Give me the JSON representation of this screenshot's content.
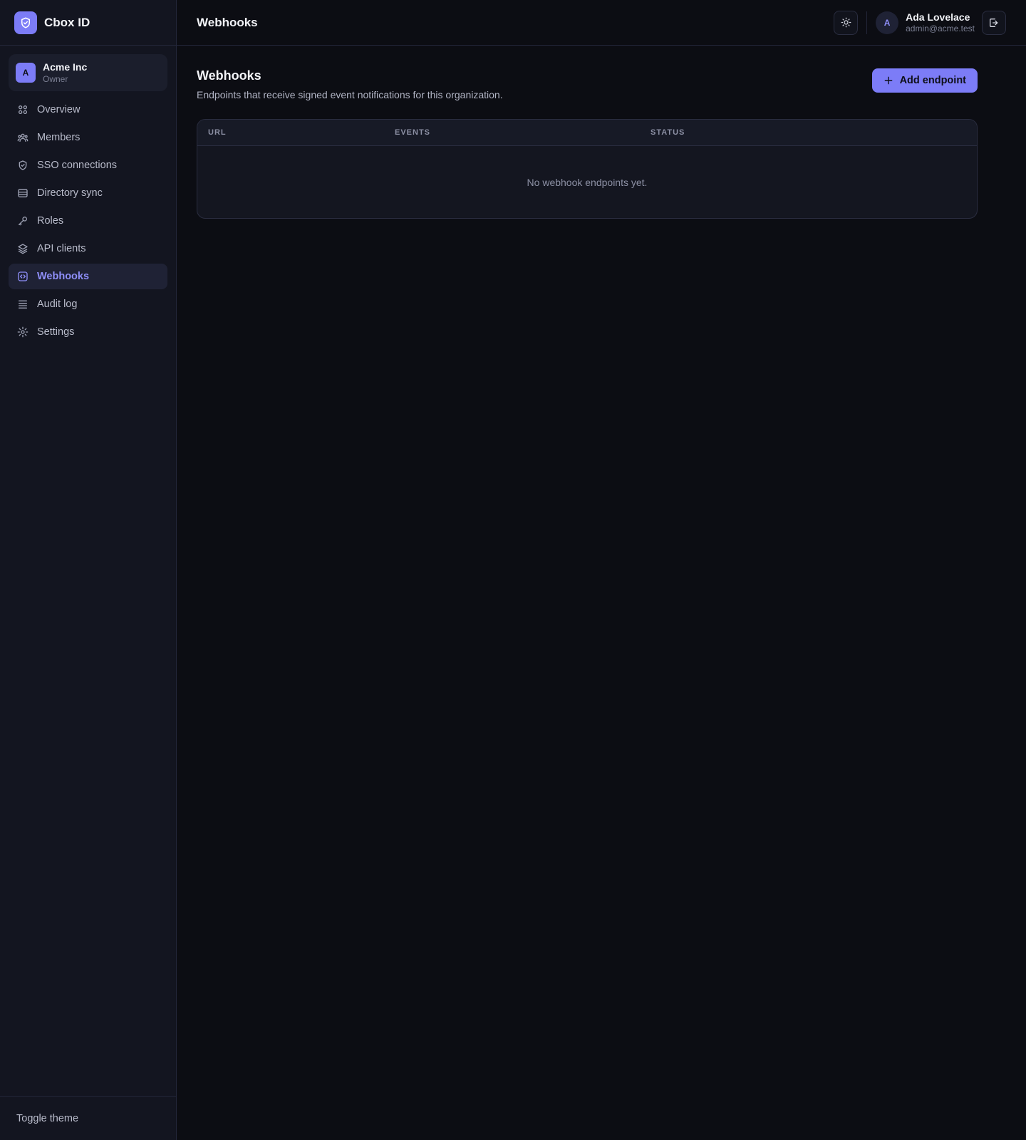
{
  "app": {
    "name": "Cbox ID"
  },
  "org": {
    "avatar": "A",
    "name": "Acme Inc",
    "role": "Owner"
  },
  "nav": [
    {
      "label": "Overview",
      "icon": "grid-icon"
    },
    {
      "label": "Members",
      "icon": "users-icon"
    },
    {
      "label": "SSO connections",
      "icon": "shield-icon"
    },
    {
      "label": "Directory sync",
      "icon": "database-icon"
    },
    {
      "label": "Roles",
      "icon": "key-icon"
    },
    {
      "label": "API clients",
      "icon": "layers-icon"
    },
    {
      "label": "Webhooks",
      "icon": "webhook-icon",
      "active": true
    },
    {
      "label": "Audit log",
      "icon": "list-icon"
    },
    {
      "label": "Settings",
      "icon": "gear-icon"
    }
  ],
  "sidebar_footer": {
    "toggle_theme": "Toggle theme"
  },
  "header": {
    "title": "Webhooks"
  },
  "user": {
    "avatar": "A",
    "name": "Ada Lovelace",
    "email": "admin@acme.test"
  },
  "page": {
    "title": "Webhooks",
    "description": "Endpoints that receive signed event notifications for this organization.",
    "add_button": "Add endpoint"
  },
  "table": {
    "columns": [
      "URL",
      "EVENTS",
      "STATUS"
    ],
    "empty_text": "No webhook endpoints yet."
  },
  "colors": {
    "accent": "#7c7cf7",
    "background": "#0c0d13",
    "sidebar": "#131520"
  }
}
